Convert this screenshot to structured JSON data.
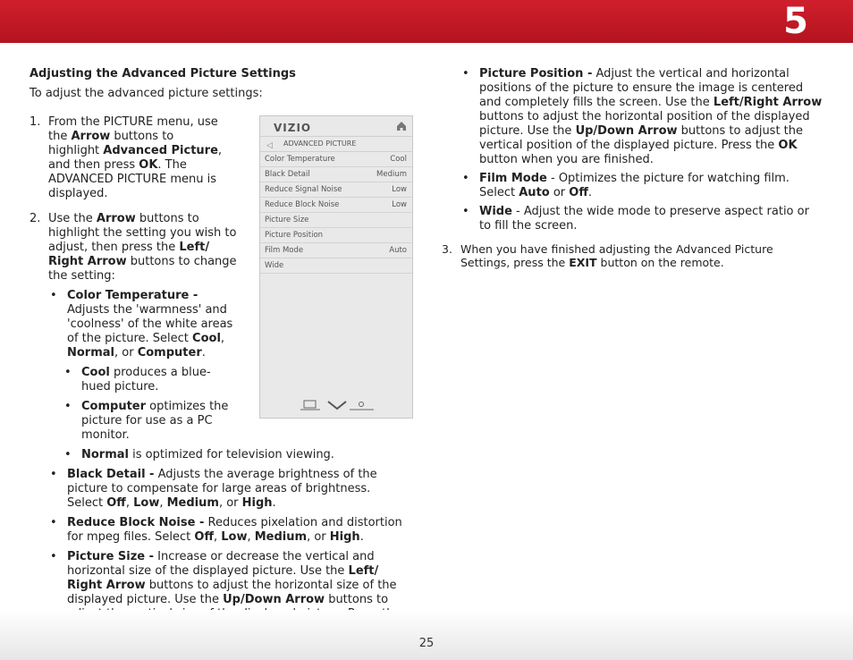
{
  "header": {
    "chapter": "5"
  },
  "footer": {
    "page": "25"
  },
  "left": {
    "heading": "Adjusting the Advanced Picture Settings",
    "intro": "To adjust the advanced picture settings:",
    "step1_num": "1.",
    "step2_num": "2.",
    "cool_name": "Cool",
    "cool_desc": " produces a blue-hued picture.",
    "computer_name": "Computer",
    "computer_desc": " optimizes the picture for use as a PC monitor.",
    "normal_name": "Normal",
    "normal_desc": " is optimized for television viewing."
  },
  "right": {
    "step3_num": "3."
  },
  "tv_menu": {
    "logo": "VIZIO",
    "title": "ADVANCED PICTURE",
    "rows": [
      {
        "label": "Color Temperature",
        "value": "Cool"
      },
      {
        "label": "Black Detail",
        "value": "Medium"
      },
      {
        "label": "Reduce Signal Noise",
        "value": "Low"
      },
      {
        "label": "Reduce Block Noise",
        "value": "Low"
      },
      {
        "label": "Picture Size",
        "value": ""
      },
      {
        "label": "Picture Position",
        "value": ""
      },
      {
        "label": "Film Mode",
        "value": "Auto"
      },
      {
        "label": "Wide",
        "value": ""
      }
    ]
  }
}
